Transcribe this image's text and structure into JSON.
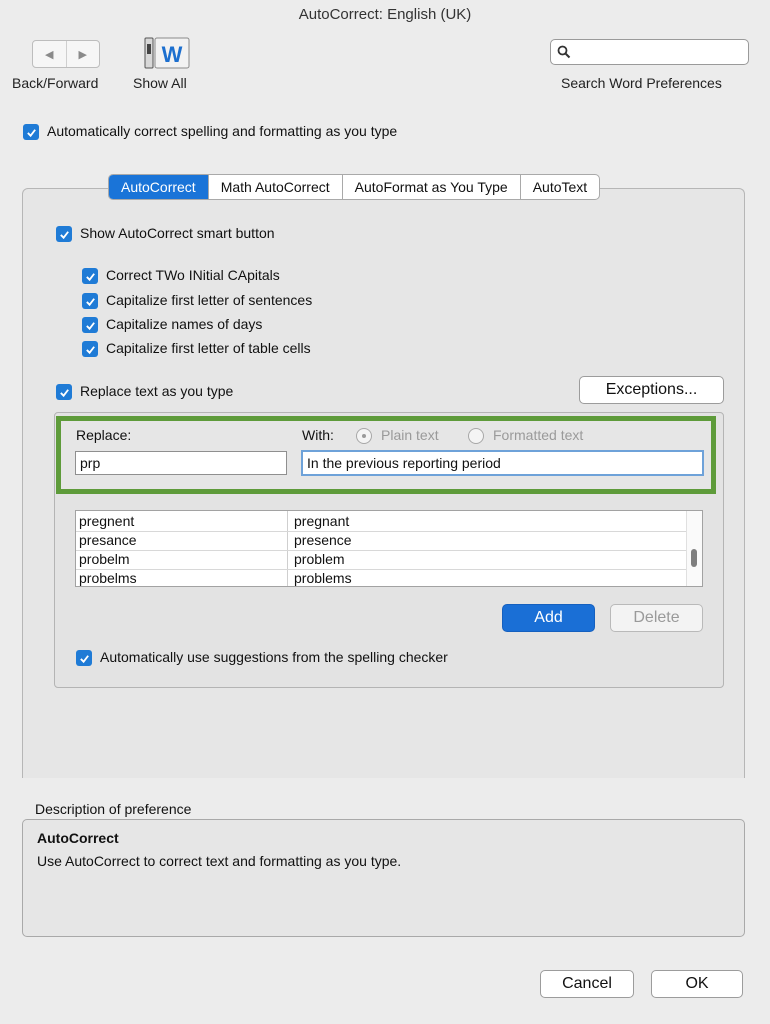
{
  "window": {
    "title": "AutoCorrect: English (UK)"
  },
  "toolbar": {
    "back_forward_label": "Back/Forward",
    "show_all_label": "Show All",
    "search_placeholder": "",
    "search_label": "Search Word Preferences"
  },
  "main_option": {
    "label": "Automatically correct spelling and formatting as you type",
    "checked": true
  },
  "tabs": [
    {
      "label": "AutoCorrect",
      "active": true
    },
    {
      "label": "Math AutoCorrect",
      "active": false
    },
    {
      "label": "AutoFormat as You Type",
      "active": false
    },
    {
      "label": "AutoText",
      "active": false
    }
  ],
  "options": {
    "show_smart_button": "Show AutoCorrect smart button",
    "correct_two_initial": "Correct TWo INitial CApitals",
    "capitalize_sentences": "Capitalize first letter of sentences",
    "capitalize_days": "Capitalize names of days",
    "capitalize_table_cells": "Capitalize first letter of table cells",
    "replace_text": "Replace text as you type"
  },
  "exceptions_button": "Exceptions...",
  "replace": {
    "replace_label": "Replace:",
    "with_label": "With:",
    "plain_text_label": "Plain text",
    "formatted_text_label": "Formatted text",
    "replace_value": "prp",
    "with_value": "In the previous reporting period"
  },
  "entries": [
    {
      "from": "pregnent",
      "to": "pregnant"
    },
    {
      "from": "presance",
      "to": "presence"
    },
    {
      "from": "probelm",
      "to": "problem"
    },
    {
      "from": "probelms",
      "to": "problems"
    }
  ],
  "add_button": "Add",
  "delete_button": "Delete",
  "suggestions_option": "Automatically use suggestions from the spelling checker",
  "description": {
    "heading": "Description of preference",
    "title": "AutoCorrect",
    "text": "Use AutoCorrect to correct text and formatting as you type."
  },
  "footer": {
    "cancel": "Cancel",
    "ok": "OK"
  },
  "colors": {
    "accent": "#1a74d8",
    "highlight_border": "#5e9b3a"
  }
}
